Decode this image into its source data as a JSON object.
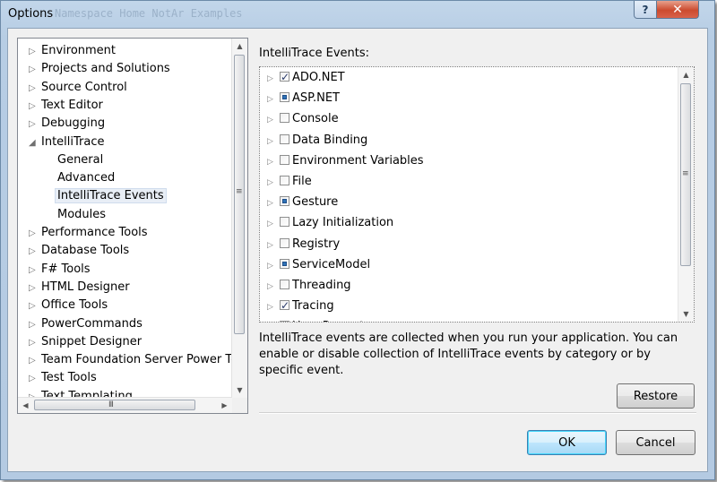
{
  "window": {
    "title": "Options",
    "ghost_title": "Namespace Home NotAr Examples",
    "help_label": "?",
    "close_label": "✕"
  },
  "tree": {
    "items": [
      {
        "label": "Environment",
        "arrow": "▷",
        "level": 0
      },
      {
        "label": "Projects and Solutions",
        "arrow": "▷",
        "level": 0
      },
      {
        "label": "Source Control",
        "arrow": "▷",
        "level": 0
      },
      {
        "label": "Text Editor",
        "arrow": "▷",
        "level": 0
      },
      {
        "label": "Debugging",
        "arrow": "▷",
        "level": 0
      },
      {
        "label": "IntelliTrace",
        "arrow": "◢",
        "level": 0
      },
      {
        "label": "General",
        "arrow": "",
        "level": 1
      },
      {
        "label": "Advanced",
        "arrow": "",
        "level": 1
      },
      {
        "label": "IntelliTrace Events",
        "arrow": "",
        "level": 1,
        "selected": true
      },
      {
        "label": "Modules",
        "arrow": "",
        "level": 1
      },
      {
        "label": "Performance Tools",
        "arrow": "▷",
        "level": 0
      },
      {
        "label": "Database Tools",
        "arrow": "▷",
        "level": 0
      },
      {
        "label": "F# Tools",
        "arrow": "▷",
        "level": 0
      },
      {
        "label": "HTML Designer",
        "arrow": "▷",
        "level": 0
      },
      {
        "label": "Office Tools",
        "arrow": "▷",
        "level": 0
      },
      {
        "label": "PowerCommands",
        "arrow": "▷",
        "level": 0
      },
      {
        "label": "Snippet Designer",
        "arrow": "▷",
        "level": 0
      },
      {
        "label": "Team Foundation Server Power To",
        "arrow": "▷",
        "level": 0
      },
      {
        "label": "Test Tools",
        "arrow": "▷",
        "level": 0
      },
      {
        "label": "Text Templating",
        "arrow": "▷",
        "level": 0
      }
    ],
    "scroll_grip": "≡",
    "hscroll_grip": "III"
  },
  "events": {
    "label": "IntelliTrace Events:",
    "items": [
      {
        "label": "ADO.NET",
        "state": "checked"
      },
      {
        "label": "ASP.NET",
        "state": "partial"
      },
      {
        "label": "Console",
        "state": "unchecked"
      },
      {
        "label": "Data Binding",
        "state": "unchecked"
      },
      {
        "label": "Environment Variables",
        "state": "unchecked"
      },
      {
        "label": "File",
        "state": "unchecked"
      },
      {
        "label": "Gesture",
        "state": "partial"
      },
      {
        "label": "Lazy Initialization",
        "state": "unchecked"
      },
      {
        "label": "Registry",
        "state": "unchecked"
      },
      {
        "label": "ServiceModel",
        "state": "partial"
      },
      {
        "label": "Threading",
        "state": "unchecked"
      },
      {
        "label": "Tracing",
        "state": "checked"
      },
      {
        "label": "User Prompts",
        "state": "unchecked"
      }
    ],
    "scroll_grip": "≡"
  },
  "description": "IntelliTrace events are collected when you run your application. You can enable or disable collection of IntelliTrace events by category or by specific event.",
  "buttons": {
    "restore": "Restore",
    "ok": "OK",
    "cancel": "Cancel"
  }
}
